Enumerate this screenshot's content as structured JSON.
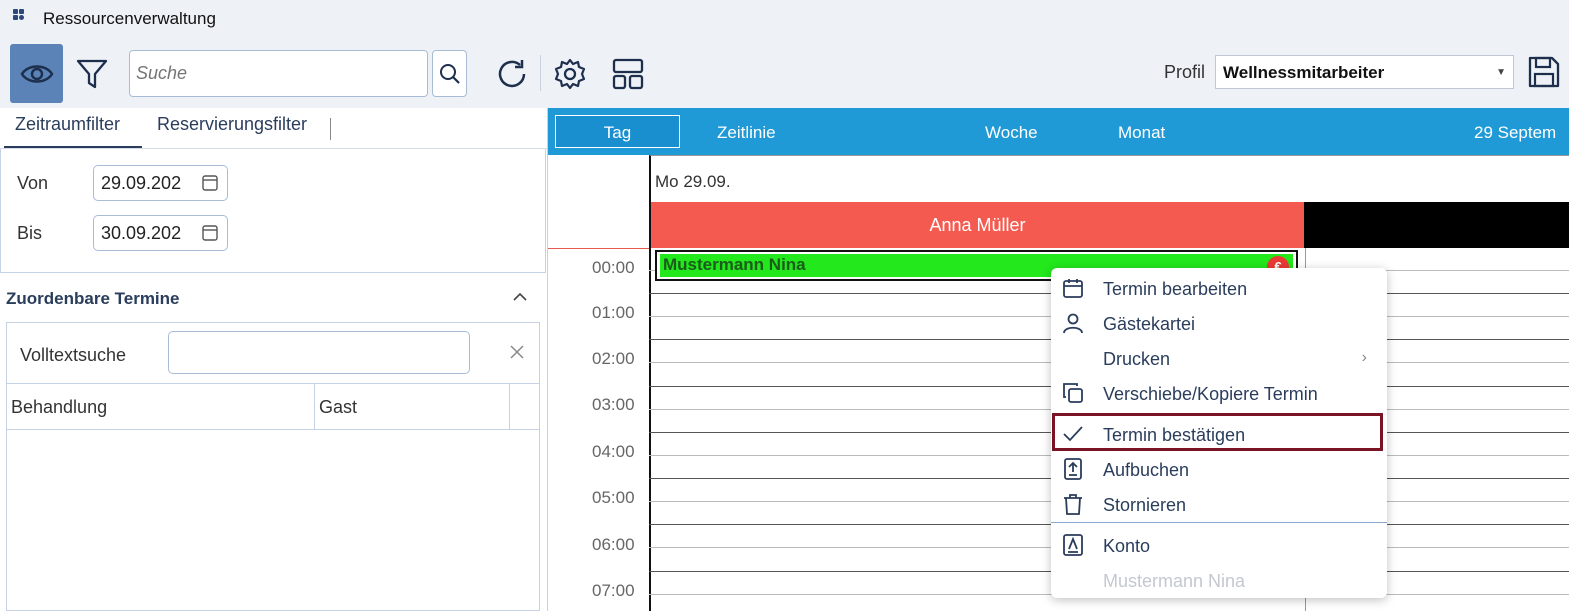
{
  "window": {
    "title": "Ressourcenverwaltung"
  },
  "toolbar": {
    "search_placeholder": "Suche",
    "profil_label": "Profil",
    "profil_value": "Wellnessmitarbeiter"
  },
  "left": {
    "tabs": [
      {
        "label": "Zeitraumfilter"
      },
      {
        "label": "Reservierungsfilter"
      }
    ],
    "von_label": "Von",
    "von_value": "29.09.202",
    "bis_label": "Bis",
    "bis_value": "30.09.202",
    "section_title": "Zuordenbare Termine",
    "volltext_label": "Volltextsuche",
    "columns": [
      "Behandlung",
      "Gast"
    ]
  },
  "calendar": {
    "views": [
      "Tag",
      "Zeitlinie",
      "Woche",
      "Monat"
    ],
    "date_range": "29 Septem",
    "day_header": "Mo 29.09.",
    "resource": "Anna Müller",
    "times": [
      "00:00",
      "01:00",
      "02:00",
      "03:00",
      "04:00",
      "05:00",
      "06:00",
      "07:00"
    ],
    "appointment": {
      "name": "Mustermann Nina",
      "badge": "€"
    }
  },
  "context_menu": {
    "items": [
      {
        "label": "Termin bearbeiten",
        "icon": "calendar-icon"
      },
      {
        "label": "Gästekartei",
        "icon": "person-icon"
      },
      {
        "label": "Drucken",
        "icon": "",
        "submenu": "›"
      },
      {
        "label": "Verschiebe/Kopiere Termin",
        "icon": "copy-icon"
      },
      {
        "label": "Termin bestätigen",
        "icon": "check-icon"
      },
      {
        "label": "Aufbuchen",
        "icon": "upload-icon"
      },
      {
        "label": "Stornieren",
        "icon": "trash-icon"
      },
      {
        "label": "Konto",
        "icon": "account-icon"
      },
      {
        "label": "Mustermann Nina",
        "icon": "",
        "disabled": true
      }
    ]
  },
  "colors": {
    "accent": "#1f9ad6",
    "resource": "#f45a50",
    "appointment": "#22e81c",
    "highlight": "#7a1424"
  }
}
